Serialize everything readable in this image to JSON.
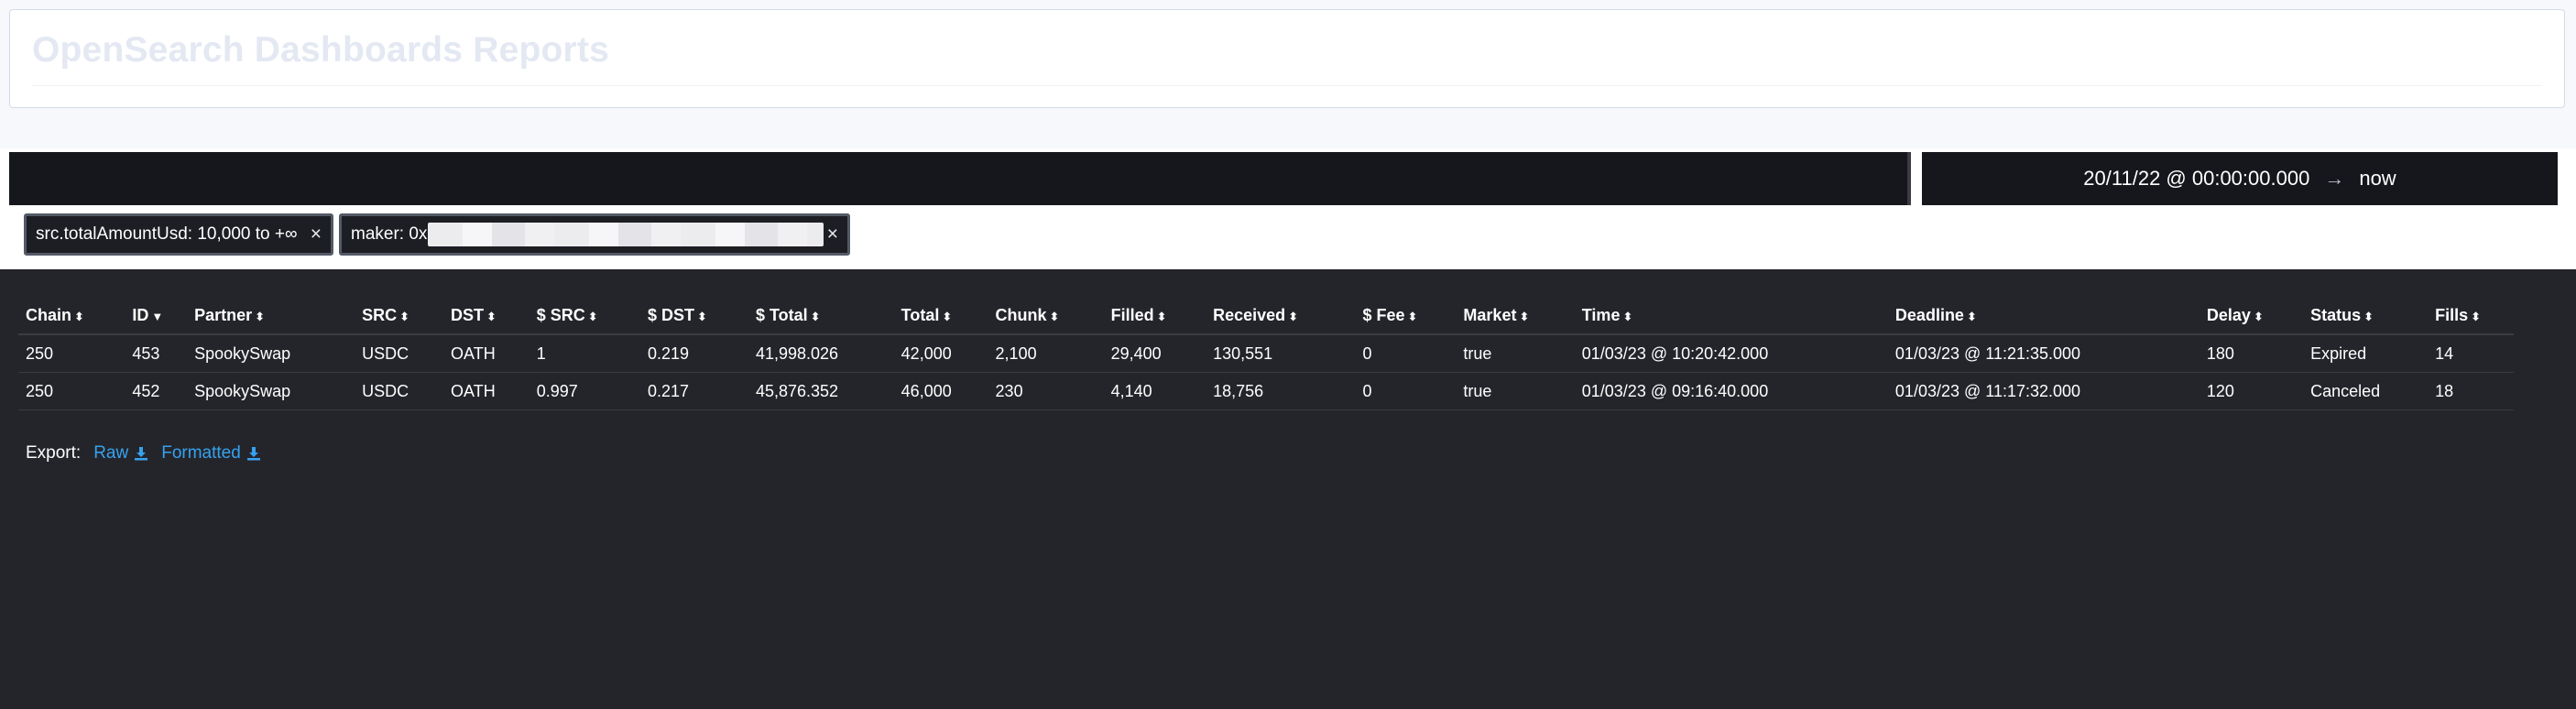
{
  "header": {
    "title": "OpenSearch Dashboards Reports"
  },
  "date_range": {
    "start": "20/11/22 @ 00:00:00.000",
    "arrow": "→",
    "end": "now"
  },
  "filters": [
    {
      "label": "src.totalAmountUsd: 10,000 to +∞",
      "close": "×"
    },
    {
      "label": "maker: 0x",
      "close": "×"
    }
  ],
  "table": {
    "columns": [
      {
        "label": "Chain",
        "sort_icon": "sort-both-icon"
      },
      {
        "label": "ID",
        "sort_icon": "sort-down-icon"
      },
      {
        "label": "Partner",
        "sort_icon": "sort-both-icon"
      },
      {
        "label": "SRC",
        "sort_icon": "sort-both-icon"
      },
      {
        "label": "DST",
        "sort_icon": "sort-both-icon"
      },
      {
        "label": "$ SRC",
        "sort_icon": "sort-both-icon"
      },
      {
        "label": "$ DST",
        "sort_icon": "sort-both-icon"
      },
      {
        "label": "$ Total",
        "sort_icon": "sort-both-icon"
      },
      {
        "label": "Total",
        "sort_icon": "sort-both-icon"
      },
      {
        "label": "Chunk",
        "sort_icon": "sort-both-icon"
      },
      {
        "label": "Filled",
        "sort_icon": "sort-both-icon"
      },
      {
        "label": "Received",
        "sort_icon": "sort-both-icon"
      },
      {
        "label": "$ Fee",
        "sort_icon": "sort-both-icon"
      },
      {
        "label": "Market",
        "sort_icon": "sort-both-icon"
      },
      {
        "label": "Time",
        "sort_icon": "sort-both-icon"
      },
      {
        "label": "Deadline",
        "sort_icon": "sort-both-icon"
      },
      {
        "label": "Delay",
        "sort_icon": "sort-both-icon"
      },
      {
        "label": "Status",
        "sort_icon": "sort-both-icon"
      },
      {
        "label": "Fills",
        "sort_icon": "sort-both-icon"
      }
    ],
    "rows": [
      [
        "250",
        "453",
        "SpookySwap",
        "USDC",
        "OATH",
        "1",
        "0.219",
        "41,998.026",
        "42,000",
        "2,100",
        "29,400",
        "130,551",
        "0",
        "true",
        "01/03/23 @ 10:20:42.000",
        "01/03/23 @ 11:21:35.000",
        "180",
        "Expired",
        "14"
      ],
      [
        "250",
        "452",
        "SpookySwap",
        "USDC",
        "OATH",
        "0.997",
        "0.217",
        "45,876.352",
        "46,000",
        "230",
        "4,140",
        "18,756",
        "0",
        "true",
        "01/03/23 @ 09:16:40.000",
        "01/03/23 @ 11:17:32.000",
        "120",
        "Canceled",
        "18"
      ]
    ]
  },
  "export": {
    "label": "Export:",
    "links": [
      {
        "label": "Raw",
        "icon": "download-icon"
      },
      {
        "label": "Formatted",
        "icon": "download-icon"
      }
    ]
  },
  "colors": {
    "accent_link": "#36a2ef",
    "dark_bg": "#24252b",
    "bar_bg": "#16171c"
  }
}
